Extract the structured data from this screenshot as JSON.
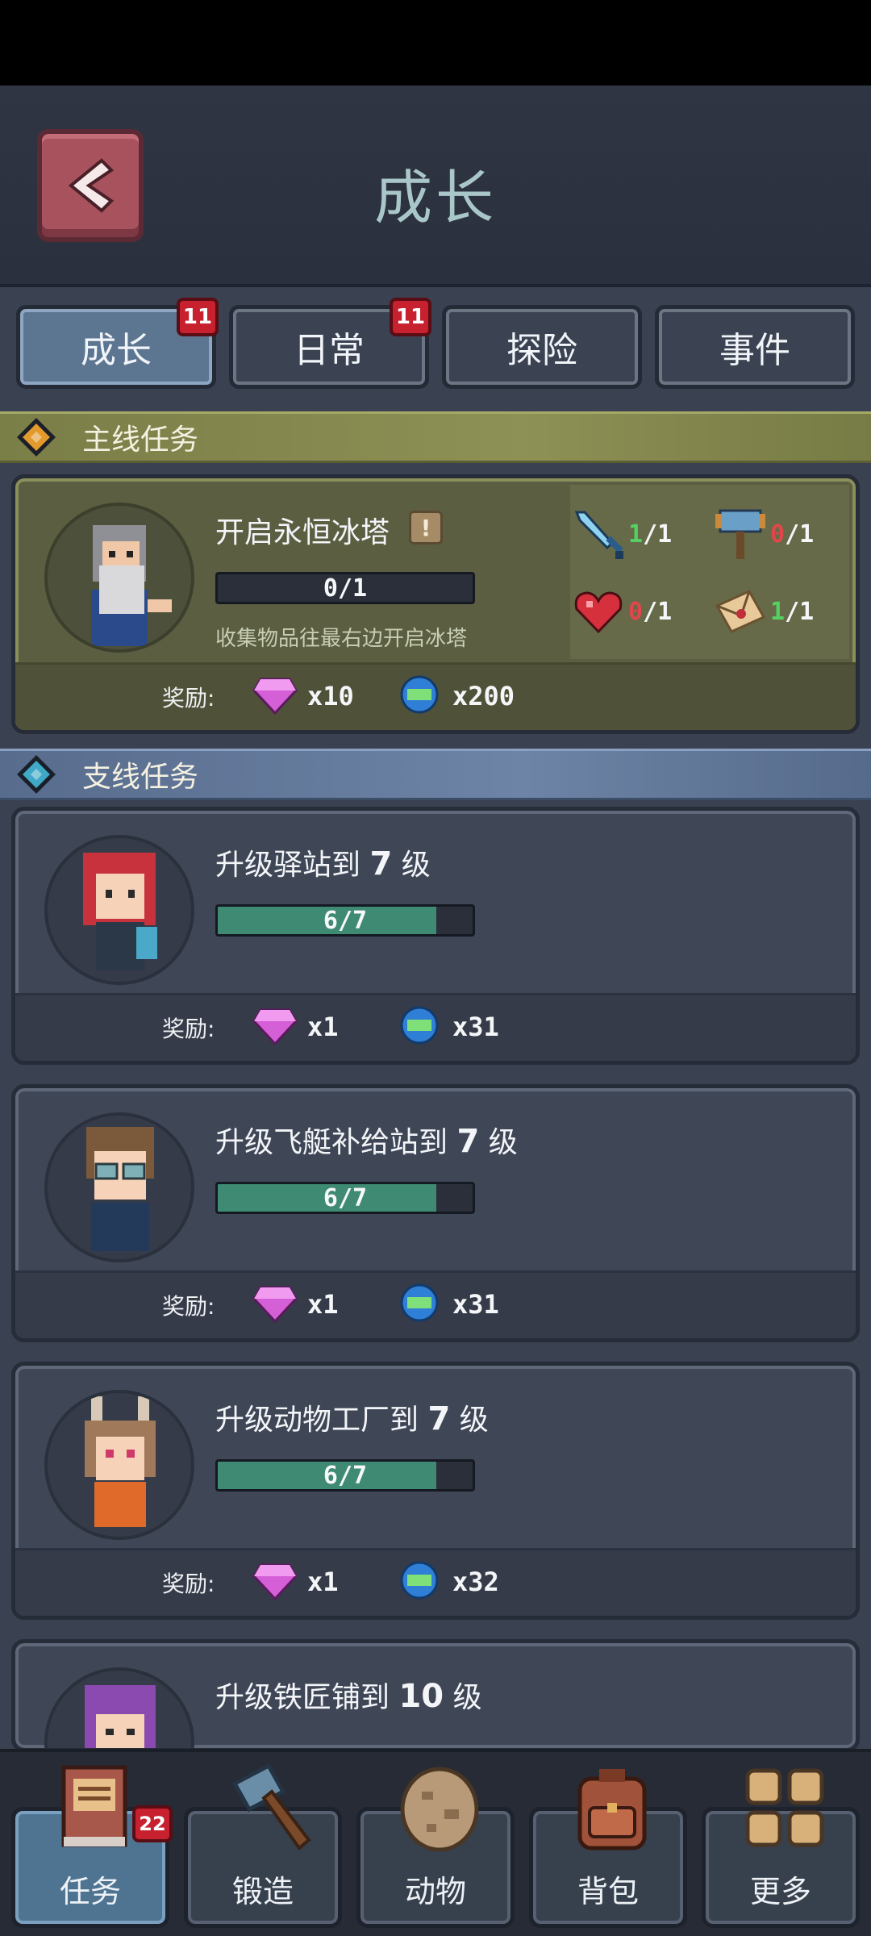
{
  "header": {
    "title": "成长"
  },
  "tabs": [
    {
      "label": "成长",
      "badge": "11",
      "active": true
    },
    {
      "label": "日常",
      "badge": "11"
    },
    {
      "label": "探险"
    },
    {
      "label": "事件"
    }
  ],
  "sections": {
    "main": "主线任务",
    "side": "支线任务"
  },
  "main_task": {
    "title": "开启永恒冰塔",
    "info_icon": "!",
    "progress": "0/1",
    "progress_fraction": 0,
    "description": "收集物品往最右边开启冰塔",
    "reward_label": "奖励:",
    "gem_qty": "x10",
    "exp_qty": "x200",
    "requirements": [
      {
        "icon": "sword-icon",
        "have": "1",
        "need": "/1",
        "met": true
      },
      {
        "icon": "hammer-icon",
        "have": "0",
        "need": "/1",
        "met": false
      },
      {
        "icon": "heart-icon",
        "have": "0",
        "need": "/1",
        "met": false
      },
      {
        "icon": "letter-icon",
        "have": "1",
        "need": "/1",
        "met": true
      }
    ]
  },
  "side_tasks": [
    {
      "title_prefix": "升级驿站到",
      "level": "7",
      "title_suffix": "级",
      "progress": "6/7",
      "progress_fraction": 0.857,
      "reward_label": "奖励:",
      "gem_qty": "x1",
      "exp_qty": "x31",
      "avatar": "red-hair-girl"
    },
    {
      "title_prefix": "升级飞艇补给站到",
      "level": "7",
      "title_suffix": "级",
      "progress": "6/7",
      "progress_fraction": 0.857,
      "reward_label": "奖励:",
      "gem_qty": "x1",
      "exp_qty": "x31",
      "avatar": "goggles-boy"
    },
    {
      "title_prefix": "升级动物工厂到",
      "level": "7",
      "title_suffix": "级",
      "progress": "6/7",
      "progress_fraction": 0.857,
      "reward_label": "奖励:",
      "gem_qty": "x1",
      "exp_qty": "x32",
      "avatar": "bunny-girl"
    },
    {
      "title_prefix": "升级铁匠铺到",
      "level": "10",
      "title_suffix": "级",
      "avatar": "purple-hair"
    }
  ],
  "bottom_nav": [
    {
      "label": "任务",
      "badge": "22",
      "icon": "quest-book-icon",
      "active": true
    },
    {
      "label": "锻造",
      "icon": "hammer-icon"
    },
    {
      "label": "动物",
      "icon": "egg-icon"
    },
    {
      "label": "背包",
      "icon": "backpack-icon"
    },
    {
      "label": "更多",
      "icon": "grid-icon"
    }
  ],
  "colors": {
    "accent_active": "#5c7591",
    "badge": "#c7202e",
    "progress_fill": "#3f8a73",
    "req_met": "#55d163",
    "req_unmet": "#e0474c"
  }
}
